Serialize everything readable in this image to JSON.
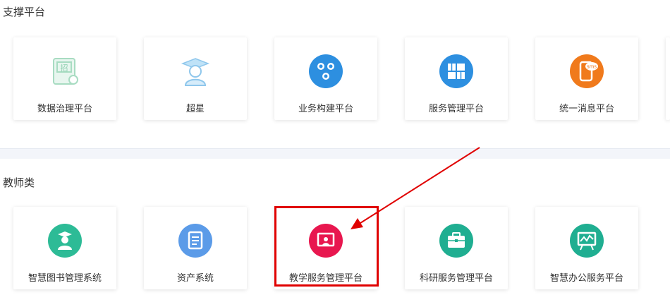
{
  "sections": [
    {
      "title": "支撑平台",
      "cards": [
        {
          "label": "数据治理平台",
          "icon": "certificate-icon",
          "color": "#a8dcc2"
        },
        {
          "label": "超星",
          "icon": "graduate-icon",
          "color": "#9ccff0"
        },
        {
          "label": "业务构建平台",
          "icon": "users-network-icon",
          "color": "#2d8fe0"
        },
        {
          "label": "服务管理平台",
          "icon": "boxes-icon",
          "color": "#2d8fe0"
        },
        {
          "label": "统一消息平台",
          "icon": "sms-phone-icon",
          "color": "#f07a1c",
          "badge": "sms"
        }
      ]
    },
    {
      "title": "教师类",
      "cards": [
        {
          "label": "智慧图书管理系统",
          "icon": "librarian-icon",
          "color": "#2dbb96"
        },
        {
          "label": "资产系统",
          "icon": "asset-document-icon",
          "color": "#5b9be8"
        },
        {
          "label": "教学服务管理平台",
          "icon": "teaching-screen-icon",
          "color": "#e8174f"
        },
        {
          "label": "科研服务管理平台",
          "icon": "briefcase-icon",
          "color": "#1fae91"
        },
        {
          "label": "智慧办公服务平台",
          "icon": "office-board-icon",
          "color": "#1fae91"
        }
      ]
    }
  ],
  "annotation_color": "#e00000"
}
